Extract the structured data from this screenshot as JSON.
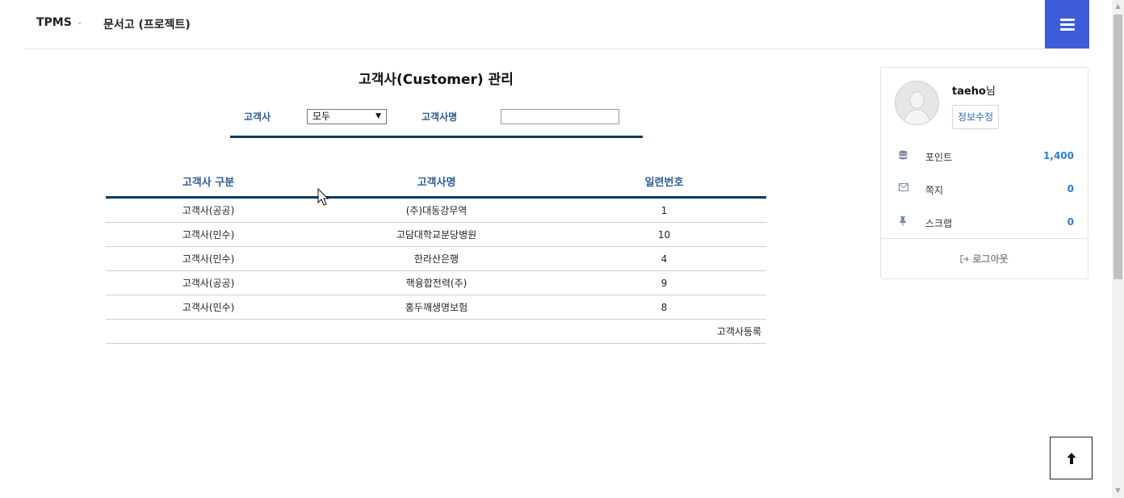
{
  "nav": {
    "brand": "TPMS",
    "brand_caret": "⌄",
    "menu_item": "문서고 (프로젝트)",
    "menu_icon": "hamburger-icon"
  },
  "page": {
    "title": "고객사(Customer) 관리"
  },
  "filter": {
    "type_label": "고객사",
    "type_selected": "모두",
    "name_label": "고객사명",
    "name_value": ""
  },
  "table": {
    "headers": [
      "고객사 구분",
      "고객사명",
      "일련번호"
    ],
    "rows": [
      [
        "고객사(공공)",
        "(주)대동강무역",
        "1"
      ],
      [
        "고객사(민수)",
        "고담대학교분당병원",
        "10"
      ],
      [
        "고객사(민수)",
        "한라산은행",
        "4"
      ],
      [
        "고객사(공공)",
        "핵융합전력(주)",
        "9"
      ],
      [
        "고객사(민수)",
        "홍두깨생명보험",
        "8"
      ]
    ],
    "register_link": "고객사등록"
  },
  "profile": {
    "username": "taeho",
    "honorific": "님",
    "edit_button": "정보수정",
    "stats": [
      {
        "icon": "database-icon",
        "label": "포인트",
        "value": "1,400"
      },
      {
        "icon": "envelope-icon",
        "label": "쪽지",
        "value": "0"
      },
      {
        "icon": "pin-icon",
        "label": "스크랩",
        "value": "0"
      }
    ],
    "logout": "로그아웃"
  },
  "scroll_top_icon": "arrow-up-icon",
  "colors": {
    "accent": "#3d5ed8",
    "header_blue": "#2b5b93",
    "rule": "#0b3a66",
    "value_blue": "#2b7fd8"
  }
}
